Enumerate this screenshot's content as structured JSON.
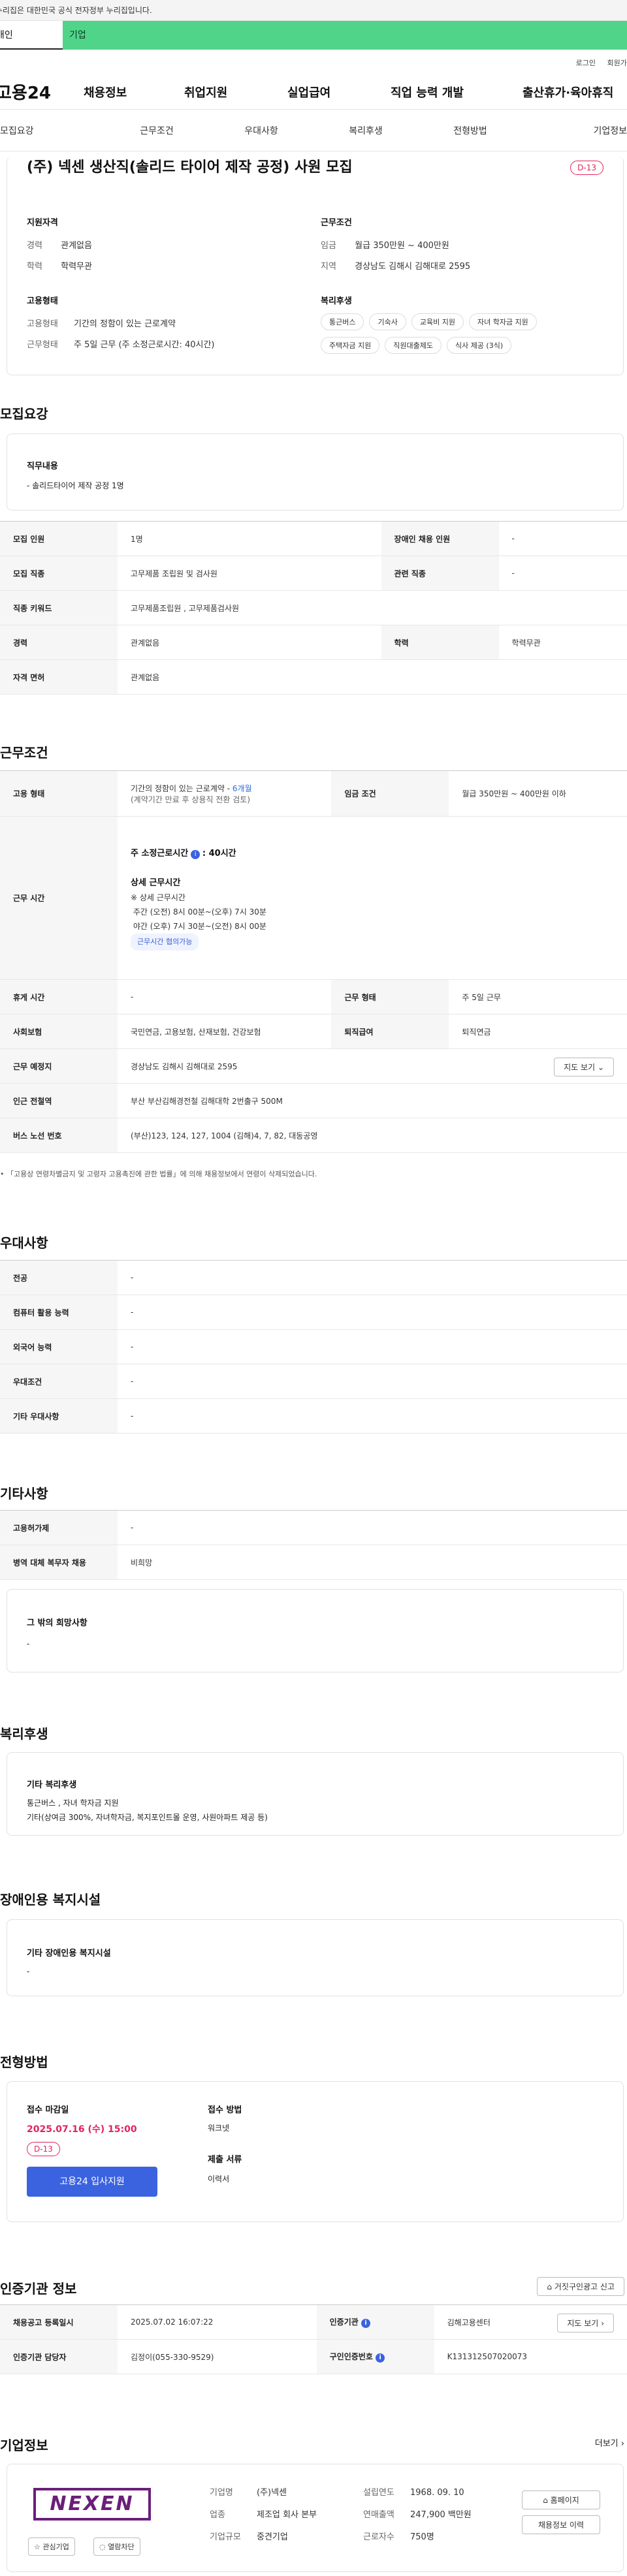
{
  "top": {
    "gov_notice": "이 누리집은 대한민국 공식 전자정부 누리집입니다.",
    "tab_person": "개인",
    "tab_company": "기업",
    "login": "로그인",
    "join": "회원가입"
  },
  "gnb": {
    "logo": "고용24",
    "menu": [
      "채용정보",
      "취업지원",
      "실업급여",
      "직업 능력 개발",
      "출산휴가·육아휴직"
    ]
  },
  "lnb": [
    "모집요강",
    "근무조건",
    "우대사항",
    "복리후생",
    "전형방법",
    "기업정보"
  ],
  "summary": {
    "title": "(주) 넥센 생산직(솔리드 타이어 제작 공정) 사원 모집",
    "dday": "D-13",
    "qual_h": "지원자격",
    "career_k": "경력",
    "career_v": "관계없음",
    "edu_k": "학력",
    "edu_v": "학력무관",
    "cond_h": "근무조건",
    "wage_k": "임금",
    "wage_v": "월급 350만원 ~ 400만원",
    "loc_k": "지역",
    "loc_v": "경상남도 김해시 김해대로 2595",
    "emp_h": "고용형태",
    "emptype_k": "고용형태",
    "emptype_v": "기간의 정함이 있는 근로계약",
    "workform_k": "근무형태",
    "workform_v": "주 5일 근무 (주 소정근로시간: 40시간)",
    "welfare_h": "복리후생",
    "tags": [
      "통근버스",
      "기숙사",
      "교육비 지원",
      "자녀 학자금 지원",
      "주택자금 지원",
      "직원대출제도",
      "식사 제공 (3식)"
    ]
  },
  "recruit": {
    "h": "모집요강",
    "duty_h": "직무내용",
    "duty_v": "- 솔리드타이어 제작 공정 1명",
    "rows": [
      [
        "모집 인원",
        "1명",
        "장애인 채용 인원",
        "-"
      ],
      [
        "모집 직종",
        "고무제품 조립원 및 검사원",
        "관련 직종",
        "-"
      ],
      [
        "직종 키워드",
        "고무제품조립원 , 고무제품검사원",
        "",
        ""
      ],
      [
        "경력",
        "관계없음",
        "학력",
        "학력무관"
      ],
      [
        "자격 면허",
        "관계없음",
        "",
        ""
      ]
    ]
  },
  "work": {
    "h": "근무조건",
    "emp_k": "고용 형태",
    "emp_v1": "기간의 정함이 있는 근로계약 - ",
    "emp_v1b": "6개월",
    "emp_v2": "(계약기간 만료 후 상용직 전환 검토)",
    "wage_k": "임금 조건",
    "wage_v": "월급 350만원 ~ 400만원 이하",
    "hours_k": "근무 시간",
    "hours_1": "주 소정근로시간",
    "hours_1b": ": 40시간",
    "hours_2": "상세 근무시간",
    "hours_3": "※ 상세 근무시간",
    "hours_4": "주간 (오전) 8시 00분~(오후) 7시 30분",
    "hours_5": "야간 (오후) 7시 30분~(오전) 8시 00분",
    "hours_tag": "근무시간 협의가능",
    "rest_k": "휴게 시간",
    "rest_v": "-",
    "form_k": "근무 형태",
    "form_v": "주 5일 근무",
    "ins_k": "사회보험",
    "ins_v": "국민연금, 고용보험, 산재보험, 건강보험",
    "ret_k": "퇴직급여",
    "ret_v": "퇴직연금",
    "place_k": "근무 예정지",
    "place_v": "경상남도 김해시 김해대로 2595",
    "map_btn": "지도 보기",
    "subway_k": "인근 전철역",
    "subway_v": "부산 부산김해경전철 김해대학 2번출구 500M",
    "bus_k": "버스 노선 번호",
    "bus_v": "(부산)123, 124, 127, 1004 (김해)4, 7, 82, 대동공영",
    "note": "「고용상 연령차별금지 및 고령자 고용촉진에 관한 법률」에 의해 채용정보에서 연령이 삭제되었습니다."
  },
  "pref": {
    "h": "우대사항",
    "rows": [
      [
        "전공",
        "-"
      ],
      [
        "컴퓨터 활용 능력",
        "-"
      ],
      [
        "외국어 능력",
        "-"
      ],
      [
        "우대조건",
        "-"
      ],
      [
        "기타 우대사항",
        "-"
      ]
    ]
  },
  "etc": {
    "h": "기타사항",
    "rows": [
      [
        "고용허가제",
        "-"
      ],
      [
        "병역 대체 복무자 채용",
        "비희망"
      ]
    ],
    "hope_h": "그 밖의 희망사항",
    "hope_v": "-"
  },
  "welfare": {
    "h": "복리후생",
    "sub_h": "기타 복리후생",
    "v1": "통근버스 , 자녀 학자금 지원",
    "v2": "기타(상여금 300%, 자녀학자금, 복지포인트몰 운영, 사원아파트 제공 등)"
  },
  "disabled": {
    "h": "장애인용 복지시설",
    "sub_h": "기타 장애인용 복지시설",
    "v": "-"
  },
  "process": {
    "h": "전형방법",
    "deadline_h": "접수 마감일",
    "deadline_v": "2025.07.16 (수) 15:00",
    "dday": "D-13",
    "apply": "고용24 입사지원",
    "method_h": "접수 방법",
    "method_v": "워크넷",
    "docs_h": "제출 서류",
    "docs_v": "이력서"
  },
  "cert": {
    "h": "인증기관 정보",
    "report": "거짓구인광고 신고",
    "reg_k": "채용공고 등록일시",
    "reg_v": "2025.07.02 16:07:22",
    "org_k": "인증기관",
    "org_v": "김해고용센터",
    "map_btn": "지도 보기",
    "mgr_k": "인증기관 담당자",
    "mgr_v": "김정이(055-330-9529)",
    "num_k": "구인인증번호",
    "num_v": "K131312507020073"
  },
  "company": {
    "h": "기업정보",
    "more": "더보기",
    "logo": "NEXEN",
    "fav": "관심기업",
    "block": "열람차단",
    "name_k": "기업명",
    "name_v": "(주)넥센",
    "ind_k": "업종",
    "ind_v": "제조업 회사 본부",
    "size_k": "기업규모",
    "size_v": "중견기업",
    "est_k": "설립연도",
    "est_v": "1968. 09. 10",
    "sales_k": "연매출액",
    "sales_v": "247,900 백만원",
    "emp_k": "근로자수",
    "emp_v": "750명",
    "home": "홈페이지",
    "history": "채용정보 이력"
  },
  "colors": {
    "accent_green": "#4fd48a",
    "brand_blue": "#3b63e0",
    "dday_red": "#e0245e",
    "logo_purple": "#6b1e7a"
  }
}
